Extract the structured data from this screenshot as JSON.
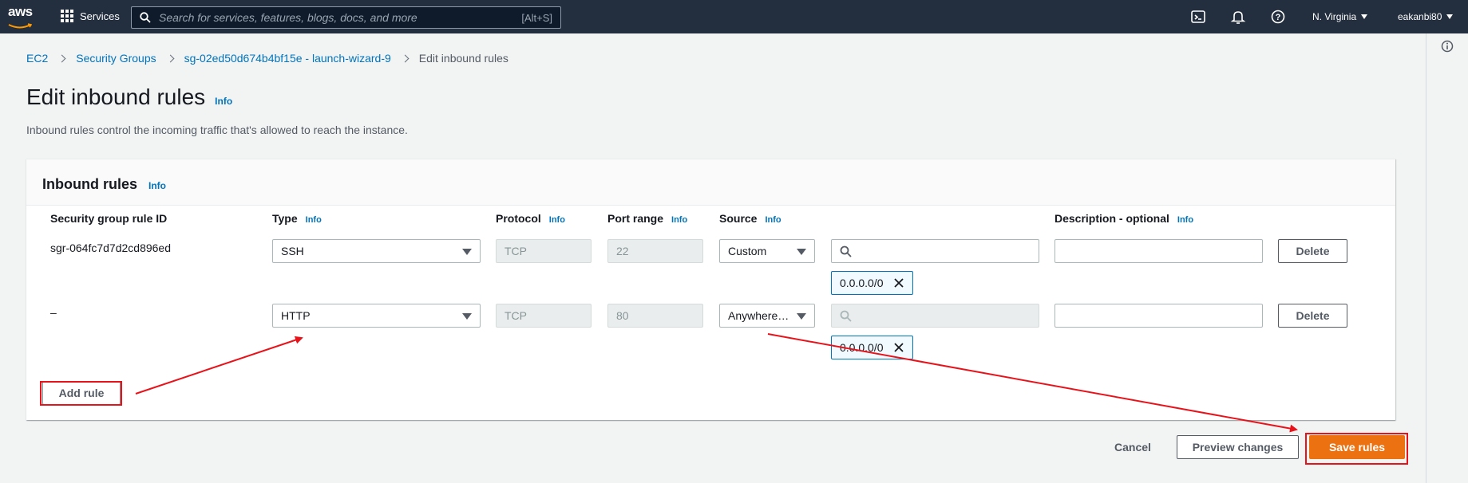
{
  "nav": {
    "logo": "aws",
    "services": "Services",
    "search_placeholder": "Search for services, features, blogs, docs, and more",
    "search_shortcut": "[Alt+S]",
    "region": "N. Virginia",
    "user": "eakanbi80"
  },
  "breadcrumb": [
    "EC2",
    "Security Groups",
    "sg-02ed50d674b4bf15e - launch-wizard-9",
    "Edit inbound rules"
  ],
  "page": {
    "title": "Edit inbound rules",
    "info": "Info",
    "description": "Inbound rules control the incoming traffic that's allowed to reach the instance."
  },
  "panel": {
    "title": "Inbound rules",
    "info": "Info",
    "columns": {
      "rule_id": "Security group rule ID",
      "type": "Type",
      "protocol": "Protocol",
      "port_range": "Port range",
      "source": "Source",
      "description": "Description - optional"
    },
    "rows": [
      {
        "rule_id": "sgr-064fc7d7d2cd896ed",
        "type": "SSH",
        "protocol": "TCP",
        "port": "22",
        "source": "Custom",
        "cidr": "0.0.0.0/0",
        "delete": "Delete"
      },
      {
        "rule_id": "–",
        "type": "HTTP",
        "protocol": "TCP",
        "port": "80",
        "source": "Anywhere…",
        "cidr": "0.0.0.0/0",
        "delete": "Delete"
      }
    ],
    "add_rule": "Add rule"
  },
  "footer": {
    "cancel": "Cancel",
    "preview": "Preview changes",
    "save": "Save rules"
  },
  "colors": {
    "accent": "#ec7211",
    "link": "#0073bb",
    "annotation": "#e8131a"
  }
}
